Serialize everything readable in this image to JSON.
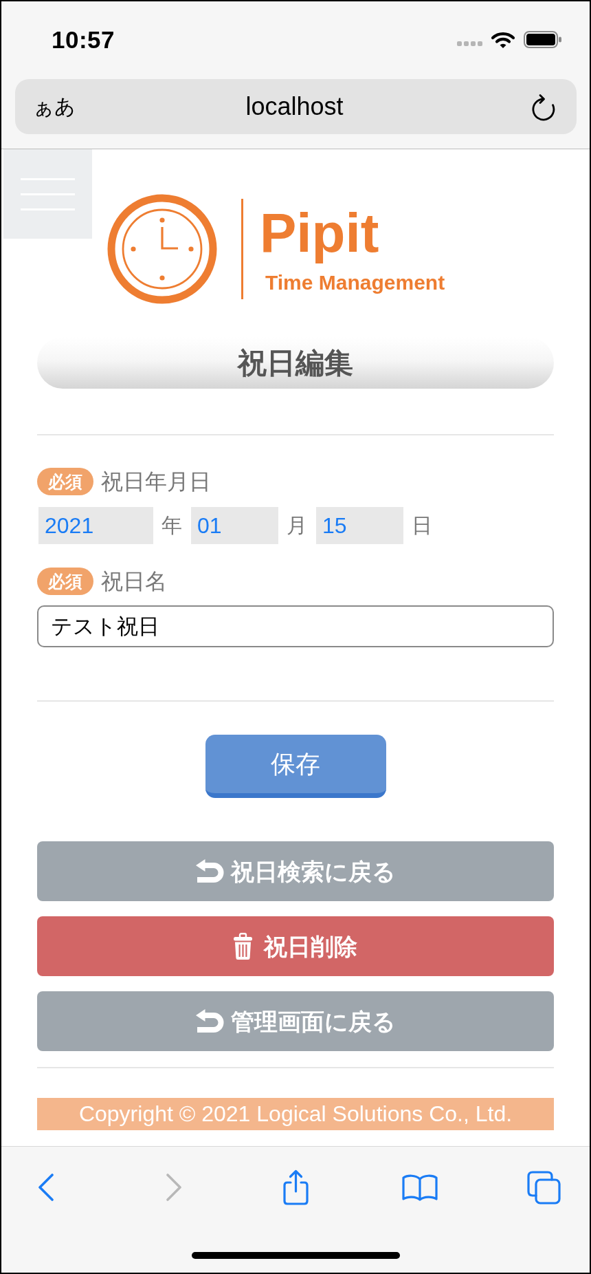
{
  "status_bar": {
    "time": "10:57"
  },
  "address_bar": {
    "text_size": "ぁあ",
    "url": "localhost"
  },
  "logo": {
    "name": "Pipit",
    "tagline": "Time Management"
  },
  "page_title": "祝日編集",
  "form": {
    "fields": [
      {
        "kind": "date",
        "badge": "必須",
        "label": "祝日年月日",
        "parts": [
          {
            "value": "2021",
            "unit": "年"
          },
          {
            "value": "01",
            "unit": "月"
          },
          {
            "value": "15",
            "unit": "日"
          }
        ]
      },
      {
        "kind": "text",
        "badge": "必須",
        "label": "祝日名",
        "value": "テスト祝日"
      }
    ]
  },
  "save_button": {
    "label": "保存"
  },
  "actions": [
    {
      "kind": "back",
      "label": "祝日検索に戻る"
    },
    {
      "kind": "delete",
      "label": "祝日削除"
    },
    {
      "kind": "back",
      "label": "管理画面に戻る"
    }
  ],
  "footer": {
    "copyright": "Copyright © 2021 Logical Solutions Co., Ltd."
  },
  "browser_toolbar": {
    "items": [
      {
        "kind": "back",
        "disabled": false
      },
      {
        "kind": "forward",
        "disabled": true
      },
      {
        "kind": "share",
        "disabled": false
      },
      {
        "kind": "bookmarks",
        "disabled": false
      },
      {
        "kind": "tabs",
        "disabled": false
      }
    ]
  }
}
